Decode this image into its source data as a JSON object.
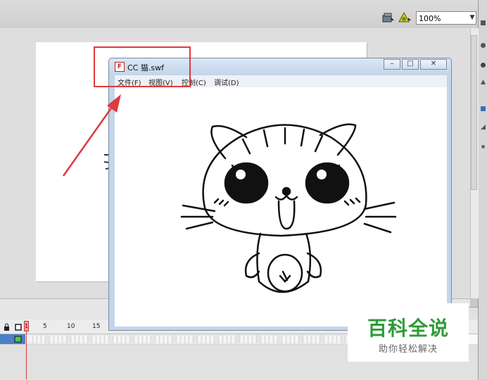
{
  "toolbar": {
    "zoom_value": "100%"
  },
  "swf_window": {
    "title": "CC 猫.swf",
    "icon_label": "F",
    "menu": [
      "文件(F)",
      "视图(V)",
      "控制(C)",
      "调试(D)"
    ],
    "minimize": "–",
    "maximize": "□",
    "close": "✕"
  },
  "timeline": {
    "frame_labels": [
      "5",
      "10",
      "15"
    ],
    "playhead_frame": "1"
  },
  "watermark": {
    "title": "百科全说",
    "subtitle": "助你轻松解决"
  },
  "colors": {
    "highlight": "#e0393e",
    "watermark_green": "#2e9b39",
    "layer_selected": "#4d7fc9"
  }
}
